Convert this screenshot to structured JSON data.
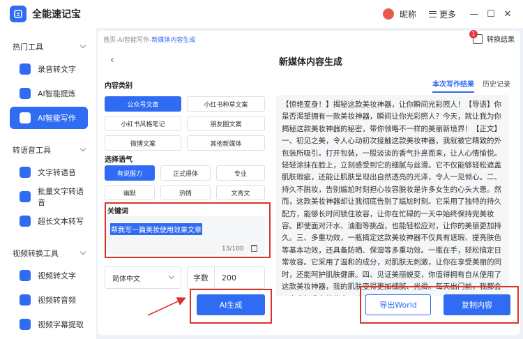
{
  "app": {
    "title": "全能速记宝"
  },
  "titlebar": {
    "nickname": "昵称",
    "more": "更多",
    "minimize": "—",
    "maximize": "☐",
    "close": "✕"
  },
  "sidebar": {
    "groups": [
      {
        "label": "热门工具",
        "items": [
          "录音转文字",
          "AI智能提炼",
          "AI智能写作"
        ]
      },
      {
        "label": "转语音工具",
        "items": [
          "文字转语音",
          "批量文字转语音",
          "超长文本转写"
        ]
      },
      {
        "label": "视频转换工具",
        "items": [
          "视频转文字",
          "视频转音频",
          "视频字幕提取"
        ]
      }
    ],
    "active": "AI智能写作"
  },
  "main": {
    "breadcrumb": {
      "home": "首页",
      "sep1": "-",
      "section": "AI智能写作",
      "sep2": "-",
      "current": "新媒体内容生成"
    },
    "convert": {
      "label": "转换结果",
      "badge": "1"
    },
    "back": "‹",
    "title": "新媒体内容生成",
    "content_type": {
      "label": "内容类别",
      "options": [
        "公众号文章",
        "小红书种草文案",
        "小红书风格笔记",
        "朋友圈文案",
        "微博文案",
        "其他新媒体"
      ],
      "selected": "公众号文章"
    },
    "tone": {
      "label": "选择语气",
      "options": [
        "有说服力",
        "正式得体",
        "专业",
        "幽默",
        "热情",
        "文青文"
      ],
      "selected": "有说服力"
    },
    "keywords": {
      "label": "关键词",
      "value": "帮我写一篇美妆使用效果文章",
      "count": "13/100"
    },
    "language": {
      "value": "简体中文"
    },
    "word_count": {
      "label": "字数",
      "value": "200"
    },
    "generate": "AI生成",
    "tabs": [
      "本次写作结果",
      "历史记录"
    ],
    "active_tab": "本次写作结果",
    "result": "【惊艳变身！】揭秘这款美妆神器，让你瞬间光彩照人！【导语】你是否渴望拥有一款美妆神器，瞬间让你光彩照人？今天，就让我为你揭秘这款美妆神器的秘密，带你领略不一样的美丽新境界！【正文】一、初见之美，令人心动初次接触这款美妆神器，我就被它精致的外包装所吸引。打开包装，一股淡淡的香气扑鼻而来，让人心情愉悦。轻轻涂抹在脸上，立刻感受到它的细腻与丝滑。它不仅能够轻松遮盖肌肤瑕疵，还能让肌肤呈现出自然透亮的光泽，令人一见倾心。二、持久不脱妆，告别尴尬时刻担心妆容脱妆是许多女生的心头大患。然而，这款美妆神器却让我彻底告别了尴尬时刻。它采用了独特的持久配方，能够长时间锁住妆容，让你在忙碌的一天中始终保持完美妆容。即使面对汗水、油脂等挑战，也能轻松应对，让你的美丽更加持久。三、多重功效，一瓶搞定这款美妆神器不仅具有遮瑕、提亮肤色等基本功效，还具备防晒、保湿等多重功效。一瓶在手，轻松搞定日常妆容。它采用了温和的成分，对肌肤无刺激，让你在享受美丽的同时，还能呵护肌肤健康。四、见证美丽蜕变，你值得拥有自从使用了这款美妆神器，我的肌肤变得更加细腻、光滑。每天出门前，我都会用它来打造完美妆容。现在，我已经离不开它了。我相信，只要你也尝试",
    "export": "导出World",
    "copy": "复制内容"
  }
}
